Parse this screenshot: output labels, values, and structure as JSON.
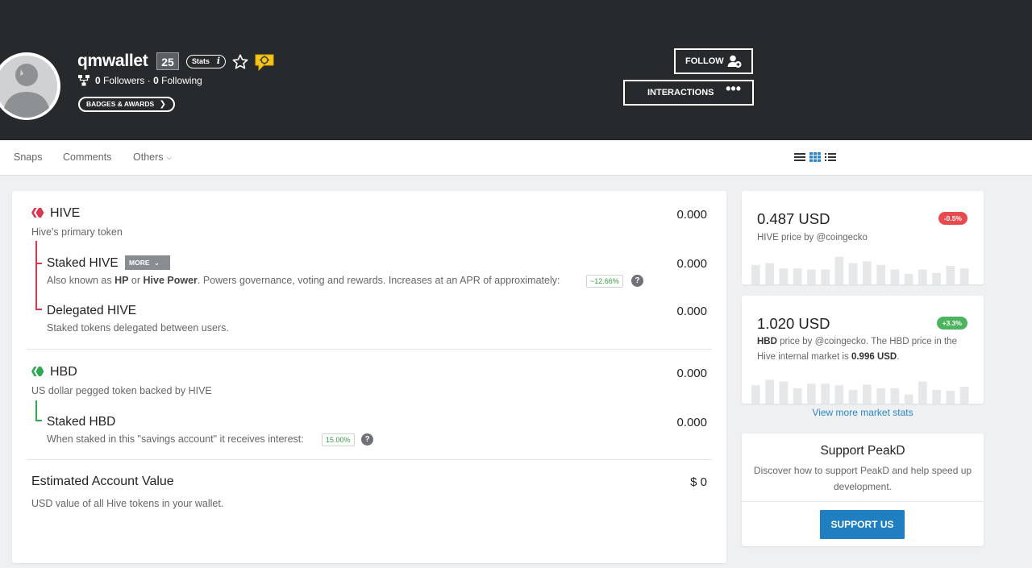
{
  "profile": {
    "username": "qmwallet",
    "reputation": "25",
    "stats_label": "Stats",
    "stats_info": "i",
    "followers_count": "0",
    "followers_label": "Followers",
    "separator": "·",
    "following_count": "0",
    "following_label": "Following",
    "badges_label": "BADGES & AWARDS",
    "follow_label": "FOLLOW",
    "interactions_label": "INTERACTIONS"
  },
  "tabs": {
    "snaps": "Snaps",
    "comments": "Comments",
    "others": "Others"
  },
  "wallet": {
    "hive": {
      "title": "HIVE",
      "desc": "Hive's primary token",
      "amount": "0.000",
      "staked": {
        "title": "Staked HIVE",
        "more_label": "MORE",
        "desc_1": "Also known as ",
        "desc_hp": "HP",
        "desc_or": " or ",
        "desc_hive_power": "Hive Power",
        "desc_2": ". Powers governance, voting and rewards. Increases at an APR of approximately:",
        "apr": "~12.66%",
        "amount": "0.000"
      },
      "delegated": {
        "title": "Delegated HIVE",
        "desc": "Staked tokens delegated between users.",
        "amount": "0.000"
      }
    },
    "hbd": {
      "title": "HBD",
      "desc": "US dollar pegged token backed by HIVE",
      "amount": "0.000",
      "staked": {
        "title": "Staked HBD",
        "desc": "When staked in this \"savings account\" it receives interest:",
        "interest": "15.00%",
        "amount": "0.000"
      }
    },
    "estimated": {
      "title": "Estimated Account Value",
      "desc": "USD value of all Hive tokens in your wallet.",
      "amount": "$ 0"
    },
    "help_glyph": "?"
  },
  "hive_price": {
    "value": "0.487 USD",
    "change": "-0.5%",
    "change_color": "#e84a4f",
    "desc_1": "HIVE price by @coingecko",
    "history": [
      0.55,
      0.6,
      0.45,
      0.45,
      0.42,
      0.42,
      0.78,
      0.6,
      0.65,
      0.55,
      0.42,
      0.3,
      0.42,
      0.32,
      0.52,
      0.45
    ]
  },
  "hbd_price": {
    "value": "1.020 USD",
    "change": "+3.3%",
    "change_color": "#4cb35f",
    "desc_a": "HBD",
    "desc_b": " price by @coingecko. The HBD price in the Hive internal market is ",
    "desc_c": "0.996 USD",
    "desc_d": ".",
    "history": [
      0.6,
      0.78,
      0.72,
      0.5,
      0.65,
      0.65,
      0.6,
      0.45,
      0.62,
      0.5,
      0.5,
      0.3,
      0.72,
      0.45,
      0.42,
      0.55
    ]
  },
  "market_link": "View more market stats",
  "support": {
    "title": "Support PeakD",
    "desc": "Discover how to support PeakD and help speed up development.",
    "button": "SUPPORT US"
  },
  "colors": {
    "header_bg": "#262a2d",
    "hive_red": "#d9374f",
    "hbd_green": "#2da94f",
    "link_blue": "#2a86c8",
    "button_blue": "#1f7fc1"
  }
}
